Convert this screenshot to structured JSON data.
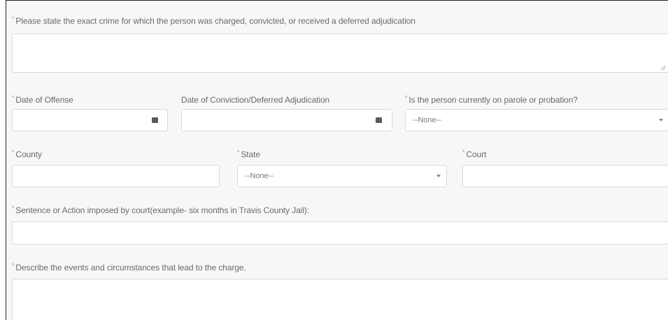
{
  "form": {
    "required_marker": "*",
    "crime": {
      "label": "Please state the exact crime for which the person was charged, convicted, or received a deferred adjudication",
      "value": ""
    },
    "date_of_offense": {
      "label": "Date of Offense",
      "value": "",
      "icon": "calendar-icon"
    },
    "date_of_conviction": {
      "label": "Date of Conviction/Deferred Adjudication",
      "value": "",
      "icon": "calendar-icon"
    },
    "parole": {
      "label": "Is the person currently on parole or probation?",
      "selected": "--None--"
    },
    "county": {
      "label": "County",
      "value": ""
    },
    "state": {
      "label": "State",
      "selected": "--None--"
    },
    "court": {
      "label": "Court",
      "value": ""
    },
    "sentence": {
      "label": "Sentence or Action imposed by court(example- six months in Travis County Jail):",
      "value": ""
    },
    "describe": {
      "label": "Describe the events and circumstances that lead to the charge.",
      "value": ""
    }
  }
}
